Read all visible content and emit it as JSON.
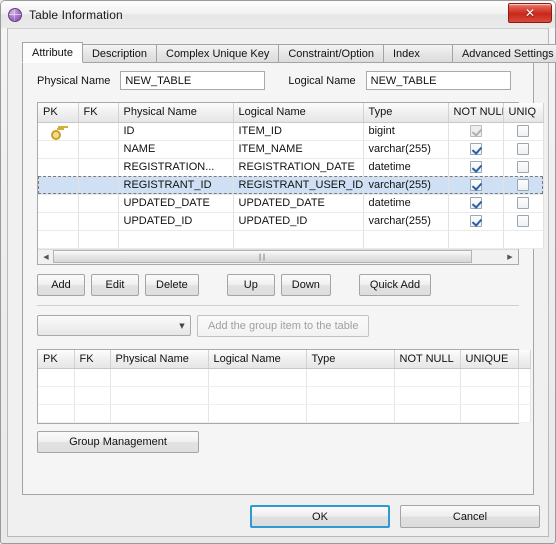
{
  "window": {
    "title": "Table Information",
    "icon": "purple-sphere-icon",
    "close_label": "✕"
  },
  "tabs": [
    {
      "label": "Attribute",
      "active": true
    },
    {
      "label": "Description",
      "active": false
    },
    {
      "label": "Complex Unique Key",
      "active": false
    },
    {
      "label": "Constraint/Option",
      "active": false
    },
    {
      "label": "Index",
      "active": false
    },
    {
      "label": "Advanced Settings",
      "active": false
    }
  ],
  "names": {
    "physical_label": "Physical Name",
    "physical_value": "NEW_TABLE",
    "logical_label": "Logical Name",
    "logical_value": "NEW_TABLE"
  },
  "attribute_grid": {
    "columns": [
      "PK",
      "FK",
      "Physical Name",
      "Logical Name",
      "Type",
      "NOT NULL",
      "UNIQ"
    ],
    "rows": [
      {
        "pk": "key-icon",
        "fk": "",
        "physical_name": "ID",
        "logical_name": "ITEM_ID",
        "type": "bigint",
        "not_null": true,
        "not_null_disabled": true,
        "unique": false,
        "selected": false
      },
      {
        "pk": "",
        "fk": "",
        "physical_name": "NAME",
        "logical_name": "ITEM_NAME",
        "type": "varchar(255)",
        "not_null": true,
        "not_null_disabled": false,
        "unique": false,
        "selected": false
      },
      {
        "pk": "",
        "fk": "",
        "physical_name": "REGISTRATION...",
        "logical_name": "REGISTRATION_DATE",
        "type": "datetime",
        "not_null": true,
        "not_null_disabled": false,
        "unique": false,
        "selected": false
      },
      {
        "pk": "",
        "fk": "",
        "physical_name": "REGISTRANT_ID",
        "logical_name": "REGISTRANT_USER_ID",
        "type": "varchar(255)",
        "not_null": true,
        "not_null_disabled": false,
        "unique": false,
        "selected": true
      },
      {
        "pk": "",
        "fk": "",
        "physical_name": "UPDATED_DATE",
        "logical_name": "UPDATED_DATE",
        "type": "datetime",
        "not_null": true,
        "not_null_disabled": false,
        "unique": false,
        "selected": false
      },
      {
        "pk": "",
        "fk": "",
        "physical_name": "UPDATED_ID",
        "logical_name": "UPDATED_ID",
        "type": "varchar(255)",
        "not_null": true,
        "not_null_disabled": false,
        "unique": false,
        "selected": false
      }
    ],
    "scrollbar": {
      "left_arrow": "◀",
      "right_arrow": "▶",
      "grip": "‖‖"
    }
  },
  "toolbar": {
    "add": "Add",
    "edit": "Edit",
    "delete": "Delete",
    "up": "Up",
    "down": "Down",
    "quick_add": "Quick Add"
  },
  "group_row": {
    "combo_value": "",
    "combo_arrow": "▼",
    "add_group_item": "Add the group item to the table",
    "add_group_item_disabled": true
  },
  "group_grid": {
    "columns": [
      "PK",
      "FK",
      "Physical Name",
      "Logical Name",
      "Type",
      "NOT NULL",
      "UNIQUE"
    ],
    "rows": [
      [],
      [],
      []
    ]
  },
  "group_management_button": "Group Management",
  "footer": {
    "ok": "OK",
    "cancel": "Cancel"
  }
}
